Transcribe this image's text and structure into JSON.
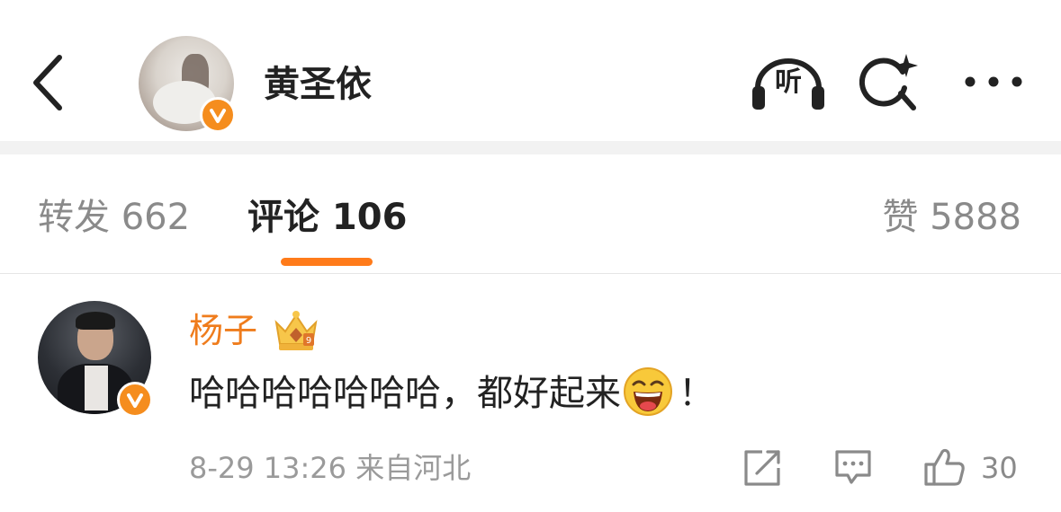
{
  "header": {
    "user_name": "黄圣依",
    "listen_label": "听"
  },
  "tabs": {
    "repost": "转发 662",
    "comment": "评论 106",
    "like": "赞 5888"
  },
  "comment": {
    "author": "杨子",
    "text_before_emoji": "哈哈哈哈哈哈哈，都好起来",
    "text_after_emoji": "！",
    "meta": "8-29 13:26 来自河北",
    "like_count": "30"
  },
  "icons": {
    "back": "chevron-left-icon",
    "listen": "headphones-icon",
    "search": "search-sparkle-icon",
    "more": "more-dots-icon",
    "verified": "verified-v-icon",
    "crown": "crown-icon",
    "emoji": "laughing-emoji-icon",
    "share": "share-icon",
    "reply": "reply-comment-icon",
    "like": "thumbs-up-icon"
  },
  "colors": {
    "accent": "#ff7b1a",
    "verified_badge": "#f58d1e",
    "author_name": "#ef7c1c"
  }
}
